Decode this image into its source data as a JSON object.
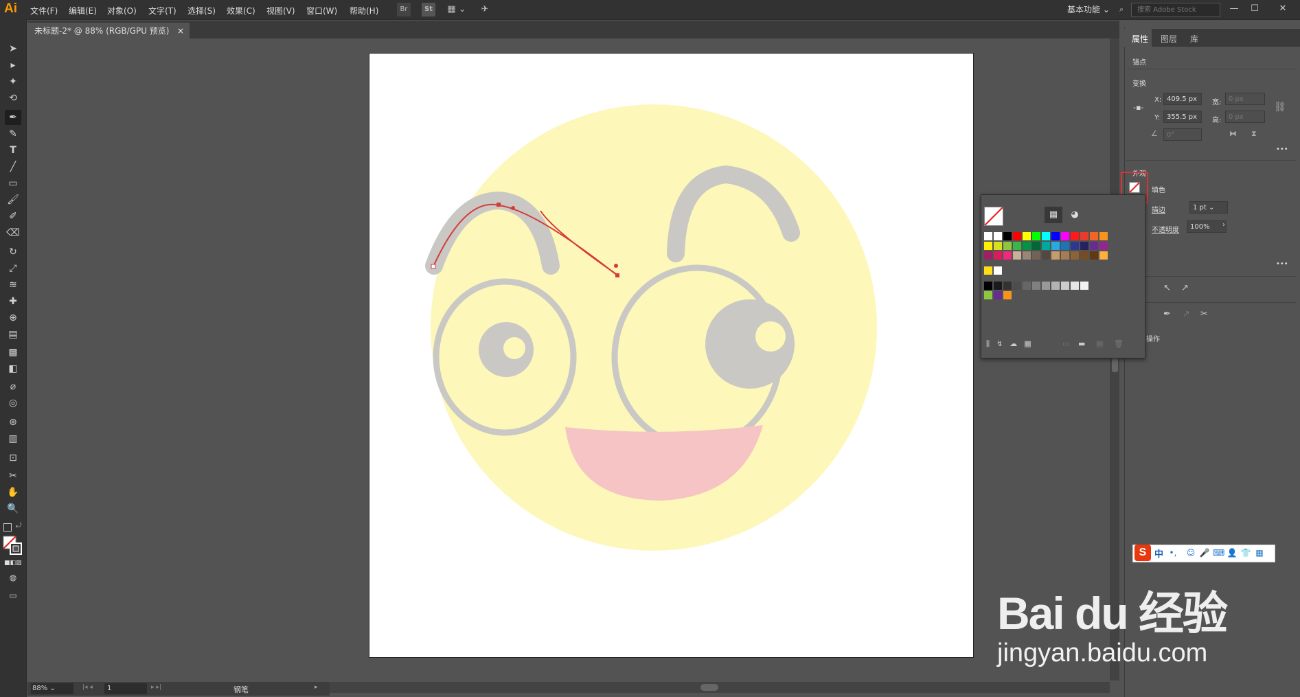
{
  "app": {
    "logo": "Ai"
  },
  "menu": [
    "文件(F)",
    "编辑(E)",
    "对象(O)",
    "文字(T)",
    "选择(S)",
    "效果(C)",
    "视图(V)",
    "窗口(W)",
    "帮助(H)"
  ],
  "toolbar_top": {
    "br": "Br",
    "st": "St"
  },
  "workspace": "基本功能",
  "stock_search": {
    "placeholder": "搜索 Adobe Stock"
  },
  "document_tab": {
    "title": "未标题-2* @ 88% (RGB/GPU 预览)",
    "close": "×"
  },
  "properties": {
    "tabs": [
      "属性",
      "图层",
      "库"
    ],
    "anchor_label": "锚点",
    "transform_label": "变换",
    "x_label": "X:",
    "x_value": "409.5 px",
    "y_label": "Y:",
    "y_value": "355.5 px",
    "w_label": "宽:",
    "w_value": "0 px",
    "h_label": "高:",
    "h_value": "0 px",
    "angle_value": "0°",
    "appearance_label": "外观",
    "fill_label": "填色",
    "stroke_label": "描边",
    "stroke_value": "1 pt",
    "opacity_label": "不透明度",
    "opacity_value": "100%",
    "ops_label": "操作",
    "more": "•••"
  },
  "status": {
    "zoom": "88%",
    "page": "1",
    "tool": "钢笔"
  },
  "ime": {
    "logo": "S",
    "lang": "中"
  },
  "watermark": {
    "line1": "Bai du 经验",
    "line2": "jingyan.baidu.com"
  },
  "colors": {
    "menubar": "#323232",
    "panel": "#535353",
    "highlight": "#e03030",
    "face": "#fdf7b9",
    "mouth": "#f6c4c4",
    "features": "#c9c8c4"
  }
}
